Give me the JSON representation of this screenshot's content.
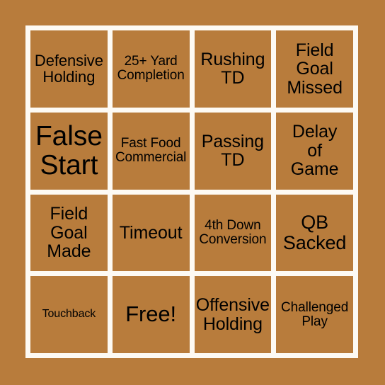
{
  "card": {
    "background_color": "#b87c3c",
    "cell_color": "#b87c3c",
    "grid_line_color": "#fdfaf4",
    "text_color": "#000000",
    "columns": 4,
    "rows": 4,
    "cells": [
      {
        "text": "Defensive\nHolding",
        "size": "m",
        "name": "bingo-cell-defensive-holding"
      },
      {
        "text": "25+ Yard\nCompletion",
        "size": "s",
        "name": "bingo-cell-25-yard-completion"
      },
      {
        "text": "Rushing\nTD",
        "size": "ml",
        "name": "bingo-cell-rushing-td"
      },
      {
        "text": "Field\nGoal\nMissed",
        "size": "ml",
        "name": "bingo-cell-field-goal-missed"
      },
      {
        "text": "False\nStart",
        "size": "xxl",
        "name": "bingo-cell-false-start"
      },
      {
        "text": "Fast Food\nCommercial",
        "size": "s",
        "name": "bingo-cell-fast-food-commercial"
      },
      {
        "text": "Passing\nTD",
        "size": "ml",
        "name": "bingo-cell-passing-td"
      },
      {
        "text": "Delay\nof\nGame",
        "size": "ml",
        "name": "bingo-cell-delay-of-game"
      },
      {
        "text": "Field\nGoal\nMade",
        "size": "ml",
        "name": "bingo-cell-field-goal-made"
      },
      {
        "text": "Timeout",
        "size": "ml",
        "name": "bingo-cell-timeout"
      },
      {
        "text": "4th Down\nConversion",
        "size": "s",
        "name": "bingo-cell-4th-down-conversion"
      },
      {
        "text": "QB\nSacked",
        "size": "l",
        "name": "bingo-cell-qb-sacked"
      },
      {
        "text": "Touchback",
        "size": "xs",
        "name": "bingo-cell-touchback"
      },
      {
        "text": "Free!",
        "size": "xl",
        "name": "bingo-cell-free-space"
      },
      {
        "text": "Offensive\nHolding",
        "size": "ml",
        "name": "bingo-cell-offensive-holding"
      },
      {
        "text": "Challenged\nPlay",
        "size": "s",
        "name": "bingo-cell-challenged-play"
      }
    ]
  }
}
